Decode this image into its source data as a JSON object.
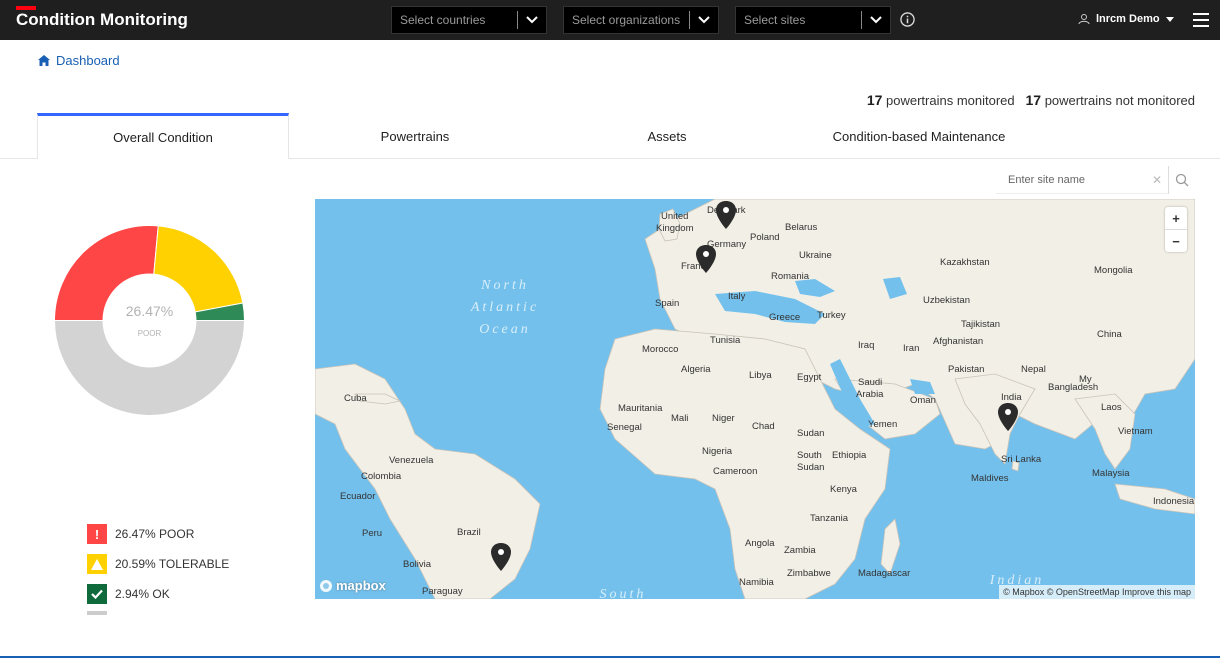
{
  "header": {
    "app_title": "Condition Monitoring",
    "filters": [
      {
        "placeholder": "Select countries"
      },
      {
        "placeholder": "Select organizations"
      },
      {
        "placeholder": "Select sites"
      }
    ],
    "user_name": "lnrcm Demo"
  },
  "breadcrumb": {
    "label": "Dashboard"
  },
  "summary": {
    "monitored_count": "17",
    "monitored_label": "powertrains monitored",
    "not_monitored_count": "17",
    "not_monitored_label": "powertrains not monitored"
  },
  "tabs": [
    {
      "label": "Overall Condition"
    },
    {
      "label": "Powertrains"
    },
    {
      "label": "Assets"
    },
    {
      "label": "Condition-based Maintenance"
    }
  ],
  "search": {
    "placeholder": "Enter site name"
  },
  "chart_data": {
    "type": "pie",
    "center_value": "26.47%",
    "center_label": "POOR",
    "slices": [
      {
        "label": "POOR",
        "value": 26.47,
        "color": "#ff4646"
      },
      {
        "label": "TOLERABLE",
        "value": 20.59,
        "color": "#ffd100"
      },
      {
        "label": "OK",
        "value": 2.94,
        "color": "#2e8b57"
      },
      {
        "label": "",
        "value": 50.0,
        "color": "#d3d3d3"
      }
    ]
  },
  "legend": [
    {
      "text": "26.47% POOR",
      "color": "#ff4646",
      "icon": "exclamation-icon"
    },
    {
      "text": "20.59% TOLERABLE",
      "color": "#ffd100",
      "icon": "warning-icon"
    },
    {
      "text": "2.94% OK",
      "color": "#0f6b3b",
      "icon": "check-icon"
    }
  ],
  "map": {
    "labels": {
      "united_kingdom_1": "United",
      "united_kingdom_2": "Kingdom",
      "denmark": "Denmark",
      "germany": "Germany",
      "poland": "Poland",
      "belarus": "Belarus",
      "ukraine": "Ukraine",
      "france": "France",
      "spain": "Spain",
      "italy": "Italy",
      "romania": "Romania",
      "greece": "Greece",
      "turkey": "Turkey",
      "morocco": "Morocco",
      "tunisia": "Tunisia",
      "algeria": "Algeria",
      "libya": "Libya",
      "egypt": "Egypt",
      "mauritania": "Mauritania",
      "mali": "Mali",
      "niger": "Niger",
      "chad": "Chad",
      "senegal": "Senegal",
      "nigeria": "Nigeria",
      "cameroon": "Cameroon",
      "sudan": "Sudan",
      "south_sudan_1": "South",
      "south_sudan_2": "Sudan",
      "ethiopia": "Ethiopia",
      "kenya": "Kenya",
      "tanzania": "Tanzania",
      "angola": "Angola",
      "zambia": "Zambia",
      "zimbabwe": "Zimbabwe",
      "namibia": "Namibia",
      "madagascar": "Madagascar",
      "iraq": "Iraq",
      "iran": "Iran",
      "saudi_arabia_1": "Saudi",
      "saudi_arabia_2": "Arabia",
      "oman": "Oman",
      "yemen": "Yemen",
      "afghanistan": "Afghanistan",
      "pakistan": "Pakistan",
      "india": "India",
      "nepal": "Nepal",
      "bangladesh": "Bangladesh",
      "sri_lanka": "Sri Lanka",
      "maldives": "Maldives",
      "kazakhstan": "Kazakhstan",
      "uzbekistan": "Uzbekistan",
      "tajikistan": "Tajikistan",
      "mongolia": "Mongolia",
      "china": "China",
      "myanmar": "My",
      "laos": "Laos",
      "vietnam": "Vietnam",
      "malaysia": "Malaysia",
      "indonesia": "Indonesia",
      "cuba": "Cuba",
      "venezuela": "Venezuela",
      "colombia": "Colombia",
      "ecuador": "Ecuador",
      "peru": "Peru",
      "brazil": "Brazil",
      "bolivia": "Bolivia",
      "paraguay": "Paraguay",
      "north_atlantic_1": "North",
      "north_atlantic_2": "Atlantic",
      "north_atlantic_3": "Ocean",
      "south": "South",
      "indian": "Indian"
    },
    "mapbox_label": "mapbox",
    "attribution": "© Mapbox © OpenStreetMap Improve this map",
    "zoom_in": "+",
    "zoom_out": "−"
  }
}
